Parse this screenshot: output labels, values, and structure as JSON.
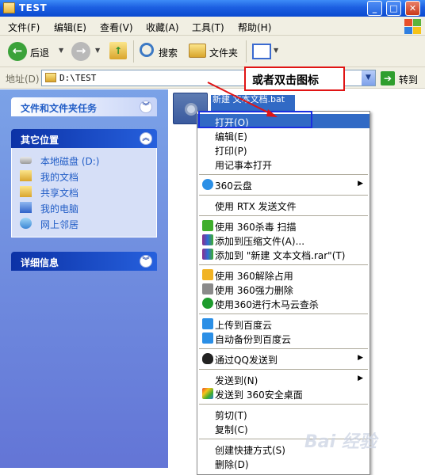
{
  "window": {
    "title": "TEST",
    "min": "_",
    "max": "□",
    "close": "✕"
  },
  "menubar": [
    {
      "label": "文件(F)"
    },
    {
      "label": "编辑(E)"
    },
    {
      "label": "查看(V)"
    },
    {
      "label": "收藏(A)"
    },
    {
      "label": "工具(T)"
    },
    {
      "label": "帮助(H)"
    }
  ],
  "toolbar": {
    "back": "后退",
    "search": "搜索",
    "folders": "文件夹"
  },
  "address": {
    "label": "地址(D)",
    "path": "D:\\TEST",
    "goto": "转到"
  },
  "tasks": {
    "file_folder_tasks": "文件和文件夹任务",
    "other_places": "其它位置",
    "places": [
      {
        "label": "本地磁盘 (D:)"
      },
      {
        "label": "我的文档"
      },
      {
        "label": "共享文档"
      },
      {
        "label": "我的电脑"
      },
      {
        "label": "网上邻居"
      }
    ],
    "details": "详细信息"
  },
  "file": {
    "name": "新建 文本文档.bat"
  },
  "annotation": "或者双击图标",
  "context_menu": [
    {
      "label": "打开(O)"
    },
    {
      "label": "编辑(E)"
    },
    {
      "label": "打印(P)"
    },
    {
      "label": "用记事本打开"
    },
    {
      "label": "360云盘"
    },
    {
      "label": "使用 RTX 发送文件"
    },
    {
      "label": "使用 360杀毒 扫描"
    },
    {
      "label": "添加到压缩文件(A)..."
    },
    {
      "label": "添加到 \"新建 文本文档.rar\"(T)"
    },
    {
      "label": "使用 360解除占用"
    },
    {
      "label": "使用 360强力删除"
    },
    {
      "label": "使用360进行木马云查杀"
    },
    {
      "label": "上传到百度云"
    },
    {
      "label": "自动备份到百度云"
    },
    {
      "label": "通过QQ发送到"
    },
    {
      "label": "发送到(N)"
    },
    {
      "label": "发送到 360安全桌面"
    },
    {
      "label": "剪切(T)"
    },
    {
      "label": "复制(C)"
    },
    {
      "label": "创建快捷方式(S)"
    },
    {
      "label": "删除(D)"
    }
  ],
  "watermark": "Bai 经验",
  "colors": {
    "accent": "#316ac5",
    "annotation_border": "#e01414",
    "highlight_box": "#1a2fe0"
  }
}
